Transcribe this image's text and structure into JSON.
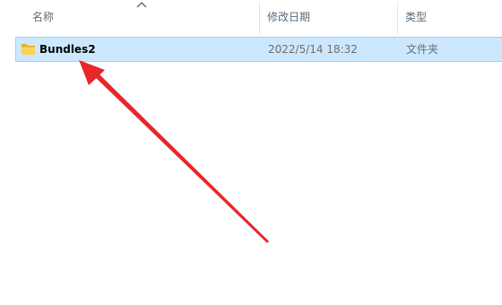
{
  "columns": {
    "name": "名称",
    "date_modified": "修改日期",
    "type": "类型"
  },
  "sort_indicator": "chevron-up-icon",
  "files": [
    {
      "name": "Bundles2",
      "date_modified": "2022/5/14 18:32",
      "type": "文件夹",
      "icon": "folder-icon",
      "selected": true
    }
  ],
  "colors": {
    "selection_bg": "#cce8ff",
    "selection_border": "#99d1ff",
    "arrow": "#e8272a",
    "folder": "#f7c948"
  }
}
